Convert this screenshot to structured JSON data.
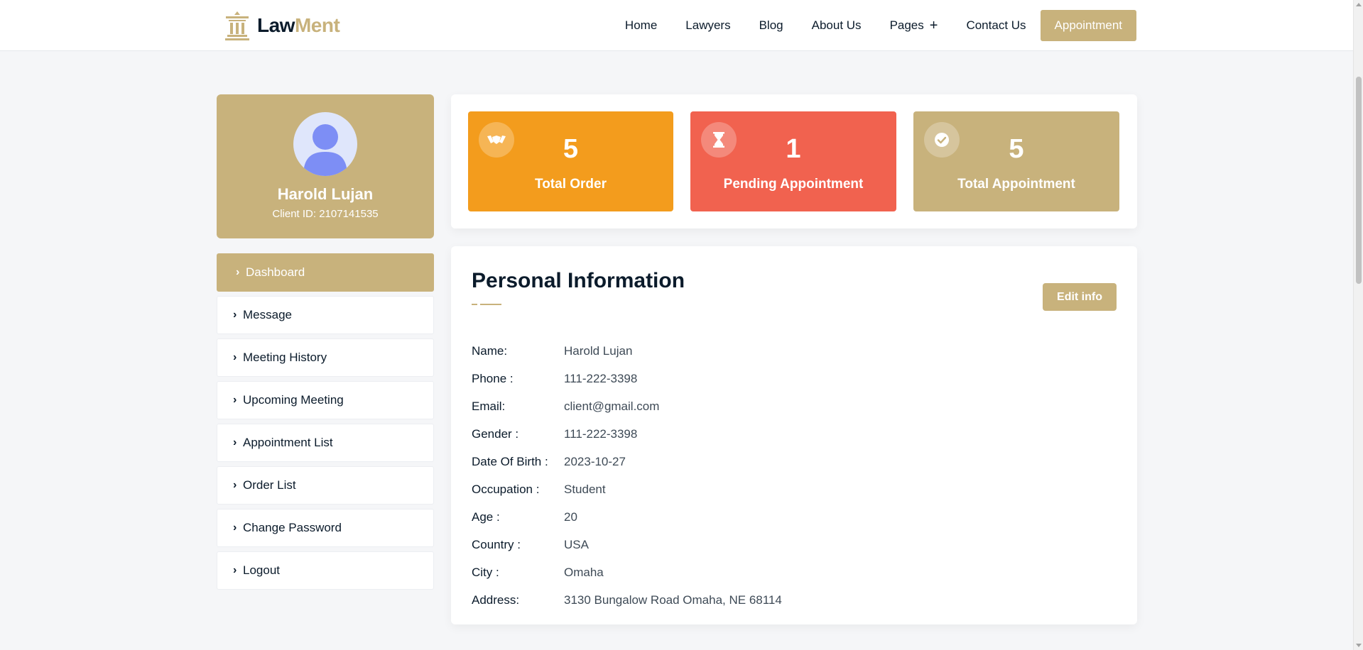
{
  "brand": {
    "name_part1": "Law",
    "name_part2": "Ment",
    "accent_color": "#c8b27c"
  },
  "nav": {
    "items": [
      "Home",
      "Lawyers",
      "Blog",
      "About Us",
      "Pages",
      "Contact Us"
    ],
    "pages_plus": "+",
    "cta": "Appointment"
  },
  "profile": {
    "name": "Harold Lujan",
    "client_id": "Client ID: 2107141535"
  },
  "menu": [
    "Dashboard",
    "Message",
    "Meeting History",
    "Upcoming Meeting",
    "Appointment List",
    "Order List",
    "Change Password",
    "Logout"
  ],
  "stats": [
    {
      "value": "5",
      "label": "Total Order",
      "color": "#f39c1d",
      "icon": "handshake-icon"
    },
    {
      "value": "1",
      "label": "Pending Appointment",
      "color": "#f1624f",
      "icon": "hourglass-icon"
    },
    {
      "value": "5",
      "label": "Total Appointment",
      "color": "#c8b27c",
      "icon": "check-circle-icon"
    }
  ],
  "personal_info": {
    "title": "Personal Information",
    "edit_button": "Edit info",
    "rows": [
      {
        "label": "Name:",
        "value": "Harold Lujan"
      },
      {
        "label": "Phone :",
        "value": "111-222-3398"
      },
      {
        "label": "Email:",
        "value": "client@gmail.com"
      },
      {
        "label": "Gender :",
        "value": "111-222-3398"
      },
      {
        "label": "Date Of Birth :",
        "value": "2023-10-27"
      },
      {
        "label": "Occupation :",
        "value": "Student"
      },
      {
        "label": "Age :",
        "value": "20"
      },
      {
        "label": "Country :",
        "value": "USA"
      },
      {
        "label": "City :",
        "value": "Omaha"
      },
      {
        "label": "Address:",
        "value": "3130 Bungalow Road Omaha, NE 68114"
      }
    ]
  }
}
